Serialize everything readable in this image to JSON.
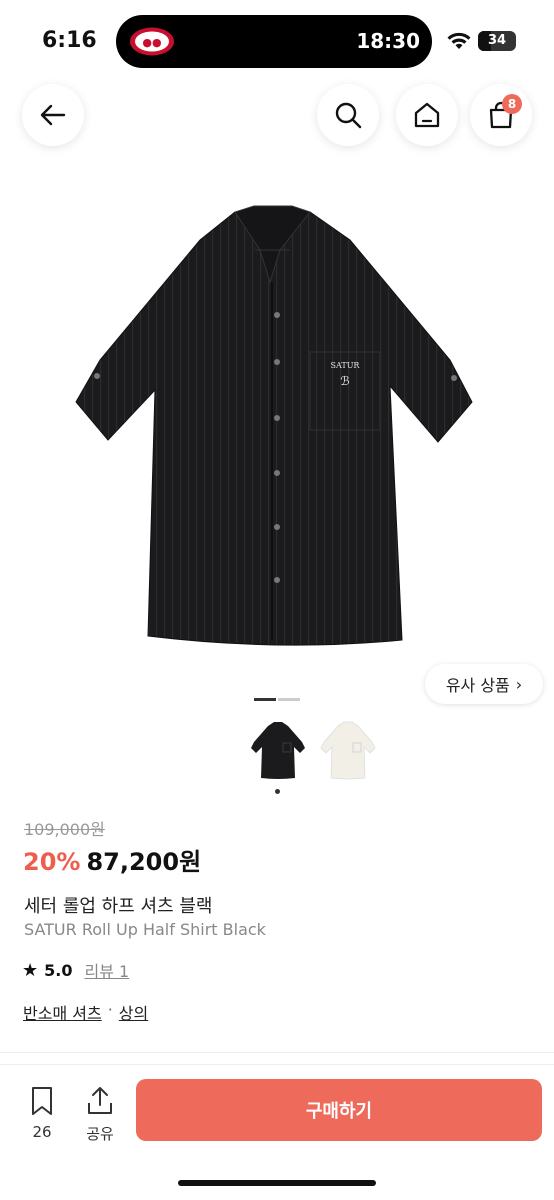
{
  "status_bar": {
    "time": "6:16",
    "island_time": "18:30",
    "battery": "34",
    "battery_level": 0.34
  },
  "nav": {
    "cart_count": "8"
  },
  "similar_button": {
    "label": "유사 상품",
    "chevron": "›"
  },
  "gallery": {
    "page_index": 1,
    "page_count": 2
  },
  "product": {
    "original_price": "109,000원",
    "discount": "20%",
    "price": "87,200원",
    "name_ko": "세터 롤업 하프 셔츠 블랙",
    "name_en": "SATUR Roll Up Half Shirt Black",
    "rating": "5.0",
    "review_label": "리뷰 1",
    "category_main": "반소매 셔츠",
    "category_separator": "·",
    "category_sub": "상의",
    "logo_text": "SATUR"
  },
  "bottom_bar": {
    "bookmark_count": "26",
    "share_label": "공유",
    "buy_label": "구매하기"
  },
  "colors": {
    "accent": "#ee6a5a",
    "discount": "#ee5e4d",
    "shirt": "#1b1b1d",
    "shirt_alt": "#f2efe6"
  }
}
